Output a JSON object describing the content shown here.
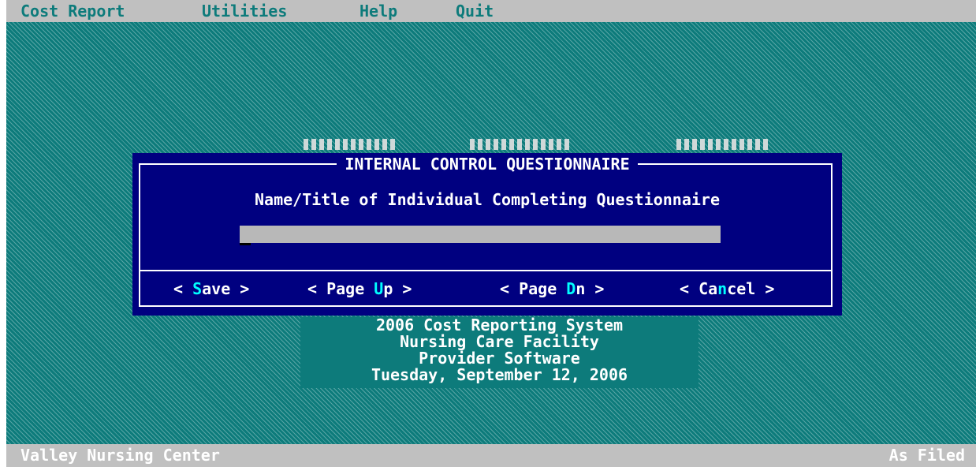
{
  "menu": {
    "items": [
      {
        "label": "Cost Report"
      },
      {
        "label": "Utilities"
      },
      {
        "label": "Help"
      },
      {
        "label": "Quit"
      }
    ]
  },
  "dialog": {
    "title": "INTERNAL CONTROL QUESTIONNAIRE",
    "prompt": "Name/Title of Individual Completing Questionnaire",
    "input": {
      "value": ""
    },
    "buttons": {
      "save": {
        "before": "< ",
        "hot": "S",
        "after": "ave >"
      },
      "page_up": {
        "before": "< Page ",
        "hot": "U",
        "after": "p >"
      },
      "page_down": {
        "before": "< Page ",
        "hot": "D",
        "after": "n >"
      },
      "cancel": {
        "before": "< Ca",
        "hot": "n",
        "after": "cel >"
      }
    }
  },
  "info": {
    "line1": "2006  Cost Reporting System",
    "line2": "Nursing Care Facility",
    "line3": "Provider Software",
    "line4": "Tuesday, September 12, 2006"
  },
  "status": {
    "left": "Valley Nursing Center",
    "right": "As Filed"
  },
  "colors": {
    "desktop": "#0d7b7b",
    "dialog_bg": "#000080",
    "hotkey": "#00ffff",
    "bars": "#c0c0c0"
  }
}
